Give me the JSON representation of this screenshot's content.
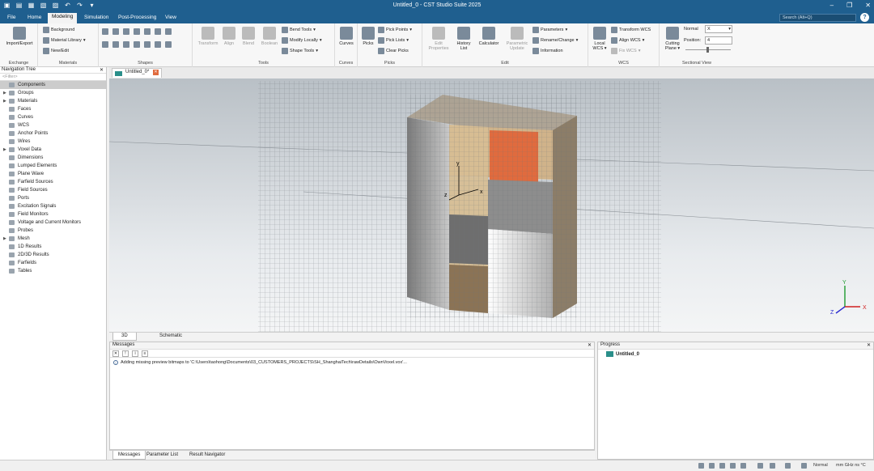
{
  "window": {
    "title": "Untitled_0 - CST Studio Suite 2025"
  },
  "menu": {
    "tabs": [
      "File",
      "Home",
      "Modeling",
      "Simulation",
      "Post-Processing",
      "View"
    ],
    "active": "Modeling",
    "search_placeholder": "Search (Alt+Q)",
    "help": "?"
  },
  "ribbon": {
    "exchange": {
      "import_export": "Import/Export",
      "label": "Exchange"
    },
    "materials": {
      "background": "Background",
      "material_library": "Material Library",
      "new_edit": "New/Edit",
      "label": "Materials"
    },
    "shapes": {
      "label": "Shapes"
    },
    "tools": {
      "transform": "Transform",
      "align": "Align",
      "boolean_blend": "Blend",
      "boolean": "Boolean",
      "bend_tools": "Bend Tools",
      "modify_locally": "Modify Locally",
      "shape_tools": "Shape Tools",
      "label": "Tools"
    },
    "curves": {
      "curves": "Curves",
      "label": "Curves"
    },
    "picks": {
      "picks": "Picks",
      "pick_points": "Pick Points",
      "pick_lists": "Pick Lists",
      "clear_picks": "Clear Picks",
      "label": "Picks"
    },
    "edit": {
      "edit_properties": "Edit Properties",
      "history_list": "History List",
      "calculator": "Calculator",
      "parametric_update": "Parametric Update",
      "parameters": "Parameters",
      "rename_change": "Rename/Change",
      "information": "Information",
      "label": "Edit"
    },
    "wcs": {
      "local_wcs": "Local WCS",
      "transform_wcs": "Transform WCS",
      "align_wcs": "Align WCS",
      "fix_wcs": "Fix WCS",
      "label": "WCS"
    },
    "sectional": {
      "cutting_plane": "Cutting Plane",
      "normal_label": "Normal",
      "normal_value": "X",
      "position_label": "Position:",
      "position_value": "4",
      "label": "Sectional View"
    }
  },
  "nav": {
    "title": "Navigation Tree",
    "filter_placeholder": "<Filter>",
    "items": [
      {
        "label": "Components",
        "expand": false,
        "selected": true
      },
      {
        "label": "Groups",
        "expand": true
      },
      {
        "label": "Materials",
        "expand": true
      },
      {
        "label": "Faces",
        "expand": false
      },
      {
        "label": "Curves",
        "expand": false
      },
      {
        "label": "WCS",
        "expand": false
      },
      {
        "label": "Anchor Points",
        "expand": false
      },
      {
        "label": "Wires",
        "expand": false
      },
      {
        "label": "Voxel Data",
        "expand": true
      },
      {
        "label": "Dimensions",
        "expand": false
      },
      {
        "label": "Lumped Elements",
        "expand": false
      },
      {
        "label": "Plane Wave",
        "expand": false
      },
      {
        "label": "Farfield Sources",
        "expand": false
      },
      {
        "label": "Field Sources",
        "expand": false
      },
      {
        "label": "Ports",
        "expand": false
      },
      {
        "label": "Excitation Signals",
        "expand": false
      },
      {
        "label": "Field Monitors",
        "expand": false
      },
      {
        "label": "Voltage and Current Monitors",
        "expand": false
      },
      {
        "label": "Probes",
        "expand": false
      },
      {
        "label": "Mesh",
        "expand": true
      },
      {
        "label": "1D Results",
        "expand": false
      },
      {
        "label": "2D/3D Results",
        "expand": false
      },
      {
        "label": "Farfields",
        "expand": false
      },
      {
        "label": "Tables",
        "expand": false
      }
    ]
  },
  "document": {
    "tab_label": "Untitled_0*"
  },
  "viewport": {
    "axis_x": "x",
    "axis_y": "y",
    "axis_z": "z",
    "triad_x": "X",
    "triad_y": "Y",
    "triad_z": "Z"
  },
  "view_tabs": [
    "3D",
    "Schematic"
  ],
  "messages": {
    "title": "Messages",
    "text": "Adding missing preview bitmaps to 'C:\\Users\\taohong\\Documents\\03_CUSTOMERS_PROJECTS\\SH_ShanghaiTech\\rawDetails\\OwnVoxel.vox'..."
  },
  "progress": {
    "title": "Progress",
    "item": "Untitled_0"
  },
  "message_tabs": [
    "Messages",
    "Parameter List",
    "Result Navigator"
  ],
  "status": {
    "mode": "Normal",
    "units": "mm  GHz  ns  °C"
  }
}
